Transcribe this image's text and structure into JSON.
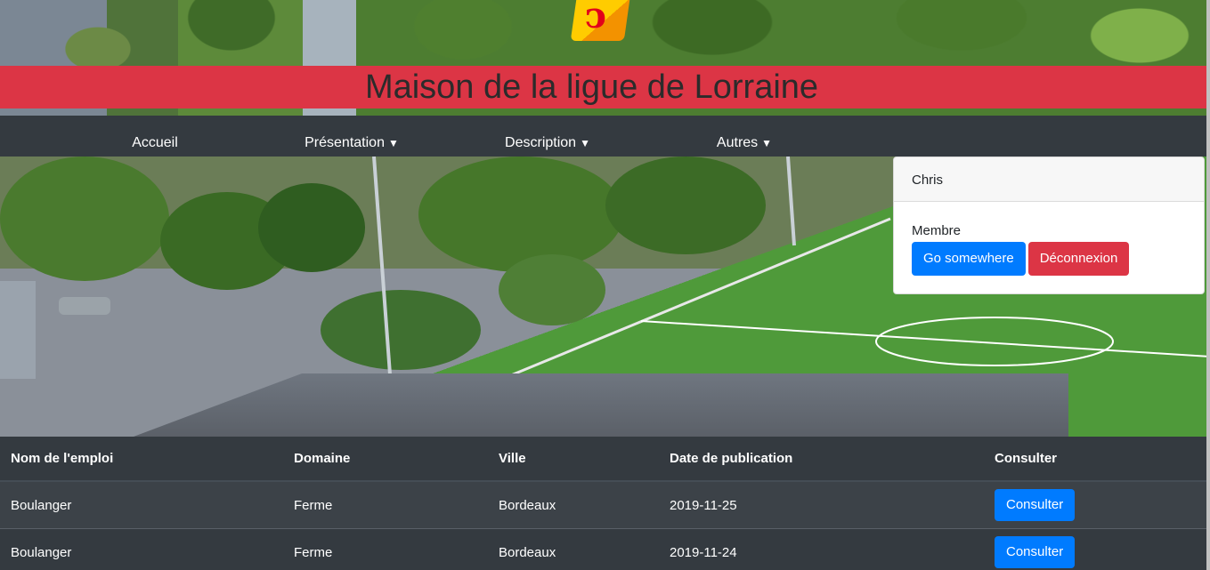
{
  "site": {
    "title": "Maison de la ligue de Lorraine"
  },
  "nav": {
    "items": [
      {
        "label": "Accueil",
        "dropdown": false
      },
      {
        "label": "Présentation",
        "dropdown": true
      },
      {
        "label": "Description",
        "dropdown": true
      },
      {
        "label": "Autres",
        "dropdown": true
      }
    ],
    "caret": "▼"
  },
  "user_card": {
    "username": "Chris",
    "role": "Membre",
    "primary_button": "Go somewhere",
    "logout_button": "Déconnexion"
  },
  "jobs_table": {
    "headers": [
      "Nom de l'emploi",
      "Domaine",
      "Ville",
      "Date de publication",
      "Consulter"
    ],
    "rows": [
      {
        "nom": "Boulanger",
        "domaine": "Ferme",
        "ville": "Bordeaux",
        "date": "2019-11-25",
        "action": "Consulter"
      },
      {
        "nom": "Boulanger",
        "domaine": "Ferme",
        "ville": "Bordeaux",
        "date": "2019-11-24",
        "action": "Consulter"
      }
    ]
  },
  "colors": {
    "brand_red": "#dc3545",
    "primary_blue": "#007bff",
    "dark": "#343a40"
  }
}
